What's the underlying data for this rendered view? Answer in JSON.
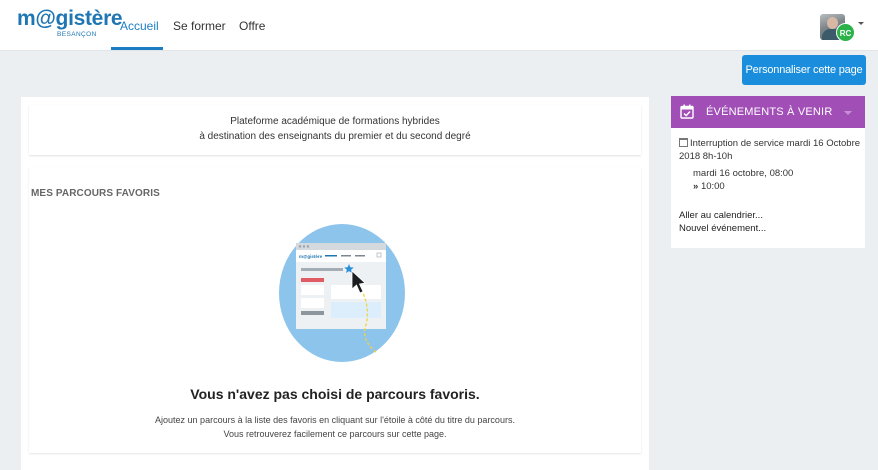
{
  "header": {
    "logo_text": "m@gistère",
    "logo_subtext": "BESANÇON",
    "tabs": [
      {
        "label": "Accueil",
        "active": true
      },
      {
        "label": "Se former",
        "active": false
      },
      {
        "label": "Offre",
        "active": false
      }
    ],
    "user_initials": "RC"
  },
  "toolbar": {
    "customize_label": "Personnaliser cette page"
  },
  "intro": {
    "line1": "Plateforme académique de formations hybrides",
    "line2": "à destination des enseignants du premier et du second degré"
  },
  "favorites": {
    "title": "MES PARCOURS FAVORIS",
    "illustration_logo": "m@gistère",
    "empty_title": "Vous n'avez pas choisi de parcours favoris.",
    "empty_line1": "Ajoutez un parcours à la liste des favoris en cliquant sur l'étoile à côté du titre du parcours.",
    "empty_line2": "Vous retrouverez facilement ce parcours sur cette page."
  },
  "events": {
    "title": "ÉVÉNEMENTS À VENIR",
    "item_title": "Interruption de service mardi 16 Octobre 2018 8h-10h",
    "item_date": "mardi 16 octobre, 08:00",
    "item_time_prefix": "»",
    "item_time": "10:00",
    "calendar_link": "Aller au calendrier...",
    "new_event_link": "Nouvel événement..."
  },
  "colors": {
    "brand_blue": "#1c7dc4",
    "button_blue": "#1a8ddc",
    "events_purple": "#a24eb7",
    "avatar_green": "#2bb34a"
  }
}
